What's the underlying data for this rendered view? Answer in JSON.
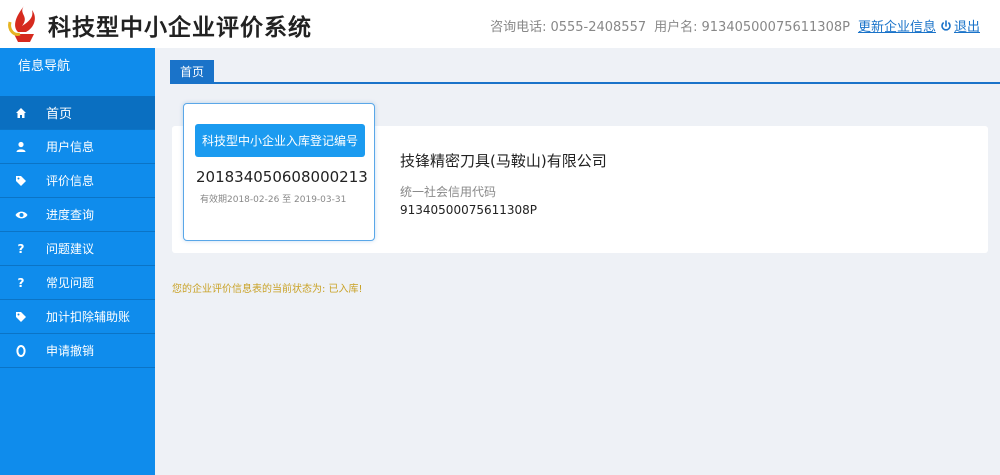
{
  "header": {
    "title": "科技型中小企业评价系统",
    "phone_label": "咨询电话:",
    "phone": "0555-2408557",
    "user_label": "用户名:",
    "user": "91340500075611308P",
    "update_link": "更新企业信息",
    "logout": "退出"
  },
  "sidebar": {
    "heading": "信息导航",
    "items": [
      {
        "label": "首页",
        "icon": "home-icon"
      },
      {
        "label": "用户信息",
        "icon": "user-icon"
      },
      {
        "label": "评价信息",
        "icon": "tag-icon"
      },
      {
        "label": "进度查询",
        "icon": "eye-icon"
      },
      {
        "label": "问题建议",
        "icon": "question-icon"
      },
      {
        "label": "常见问题",
        "icon": "question-icon"
      },
      {
        "label": "加计扣除辅助账",
        "icon": "tag-icon"
      },
      {
        "label": "申请撤销",
        "icon": "circle-icon"
      }
    ]
  },
  "tabs": [
    {
      "label": "首页"
    }
  ],
  "registration": {
    "button": "科技型中小企业入库登记编号",
    "number": "201834050608000213",
    "valid": "有效期2018-02-26 至 2019-03-31"
  },
  "company": {
    "name": "技锋精密刀具(马鞍山)有限公司",
    "credit_label": "统一社会信用代码",
    "credit_code": "91340500075611308P"
  },
  "status": "您的企业评价信息表的当前状态为: 已入库!",
  "colors": {
    "sidebar": "#0f8cec",
    "accent": "#1a73c9",
    "status": "#c9a227"
  }
}
